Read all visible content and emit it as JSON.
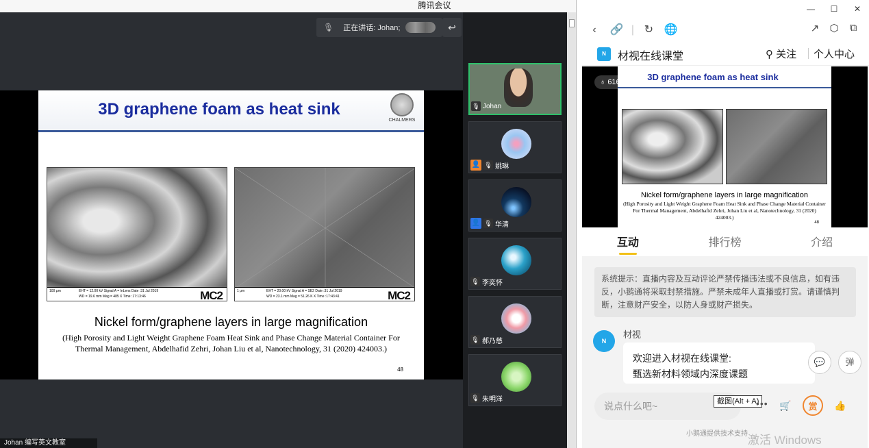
{
  "window": {
    "title": "腾讯会议"
  },
  "meeting": {
    "speaking_text": "正在讲话: Johan;",
    "bottom_name": "Johan  编写英文教室"
  },
  "slide": {
    "title": "3D graphene foam as heat sink",
    "seal_text": "CHALMERS",
    "image_left": {
      "scale": "100 μm",
      "params_a": "EHT = 12.00 kV   Signal A = InLens   Date :31 Jul 2019",
      "params_b": "WD = 19.6 mm   Mag = 485 X   Time :17:13:46",
      "logo": "MC2"
    },
    "image_right": {
      "scale": "1 μm",
      "params_a": "EHT = 20.00 kV   Signal A = SE2   Date :31 Jul 2019",
      "params_b": "WD = 23.1 mm   Mag = 51.26 K X   Time :17:43:41",
      "logo": "MC2"
    },
    "caption": "Nickel form/graphene layers in large magnification",
    "reference": "(High Porosity and Light Weight Graphene Foam Heat Sink and Phase Change Material Container For Thermal Management, Abdelhafid Zehri, Johan Liu et al, Nanotechnology, 31 (2020) 424003.)",
    "page_number": "48"
  },
  "participants": [
    {
      "name": "Johan",
      "mic": "unmuted",
      "role": ""
    },
    {
      "name": "姚琳",
      "mic": "muted",
      "role": "host"
    },
    {
      "name": "华清",
      "mic": "muted",
      "role": "cohost"
    },
    {
      "name": "李奕怀",
      "mic": "muted",
      "role": ""
    },
    {
      "name": "郝乃慈",
      "mic": "muted",
      "role": ""
    },
    {
      "name": "朱明洋",
      "mic": "muted",
      "role": ""
    }
  ],
  "panel": {
    "app_name": "材视在线课堂",
    "follow": "关注",
    "personal_center": "个人中心",
    "viewer_count": "6160",
    "live_slide": {
      "title": "3D graphene foam as heat sink",
      "caption": "Nickel form/graphene layers in large magnification",
      "reference": "(High Porosity and Light Weight Graphene Foam Heat Sink and Phase Change Material Container For Thermal Management, Abdelhafid Zehri, Johan Liu et al, Nanotechnology, 31 (2020) 424003.)",
      "page_number": "48"
    },
    "tabs": [
      "互动",
      "排行榜",
      "介绍"
    ],
    "notice": "系统提示：直播内容及互动评论严禁传播违法或不良信息，如有违反，小鹅通将采取封禁措施。严禁未成年人直播或打赏。请谨慎判断，注意财产安全，以防人身或财产损失。",
    "message": {
      "sender": "材视",
      "line1": "欢迎进入材视在线课堂:",
      "line2": "甄选新材料领域内深度课题"
    },
    "float_btn_danmu": "弹",
    "input_placeholder": "说点什么吧~",
    "tooltip": "截图(Alt + A)",
    "reward_label": "赏",
    "footer_note": "小鹅通提供技术支持",
    "watermark": "激活 Windows"
  },
  "colors": {
    "meeting_bg": "#26292d",
    "slide_title": "#1b2d9e",
    "active_speaker_border": "#2ec06a",
    "host_badge": "#f0862f",
    "cohost_badge": "#2f76e8",
    "tab_underline": "#f2c018",
    "brand": "#23a6e8"
  }
}
